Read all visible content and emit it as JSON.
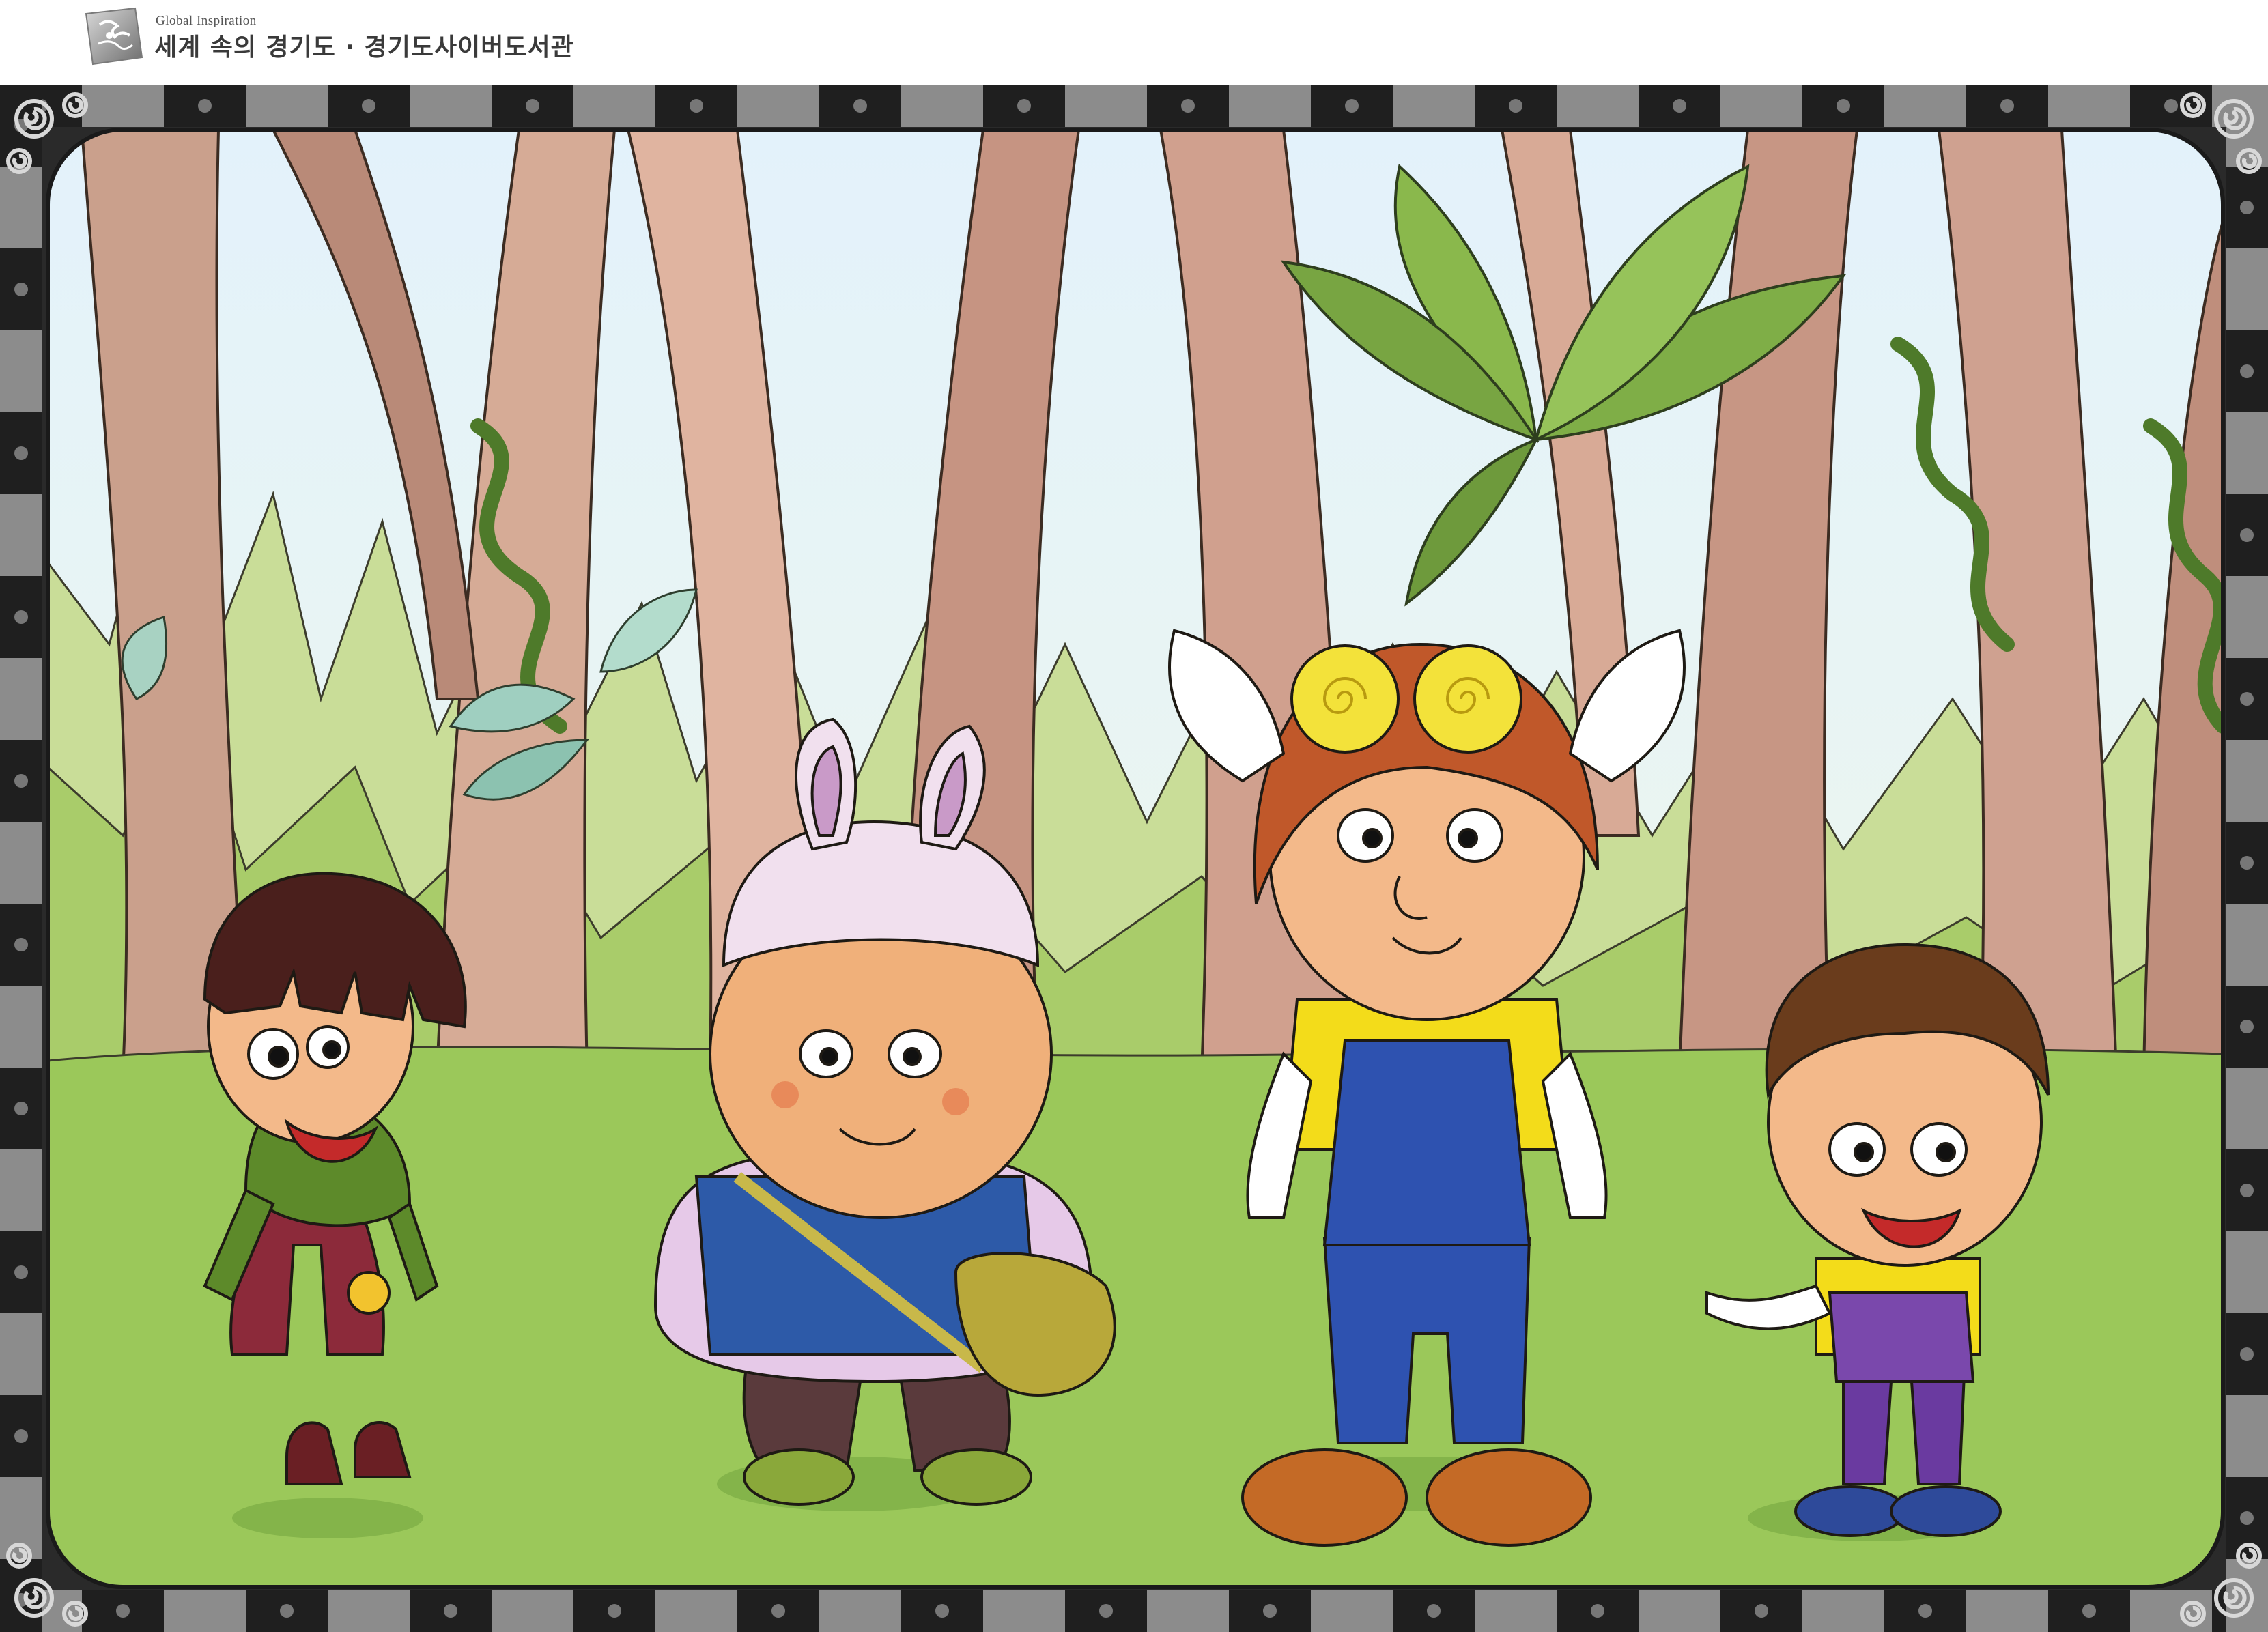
{
  "header": {
    "tagline": "Global Inspiration",
    "site_title": "세계 속의 경기도 · 경기도사이버도서관",
    "logo_icon": "swirl-emblem-icon"
  },
  "scene": {
    "illustration": "forest-scene",
    "characters": [
      "bowl-cut-boy",
      "bunny-hat-boy",
      "goggle-helmet-hero",
      "pointing-boy"
    ],
    "colors": {
      "frame_dark": "#1f1f1f",
      "frame_gray": "#8c8c8c",
      "sky": "#e6f3fb",
      "grass": "#9bc85a",
      "tree_trunk": "#c99884",
      "leaf": "#7fae47"
    }
  }
}
